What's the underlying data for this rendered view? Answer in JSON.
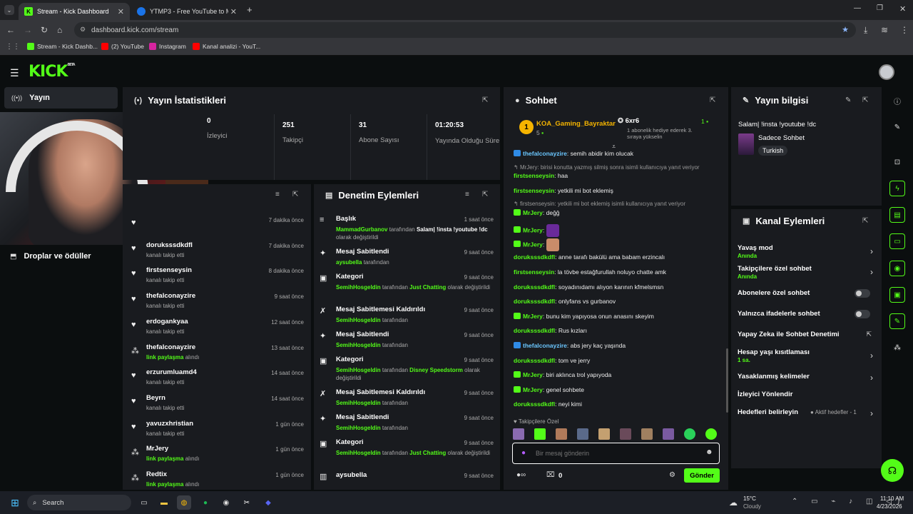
{
  "browser": {
    "tabs": [
      {
        "title": "Stream - Kick Dashboard",
        "active": true
      },
      {
        "title": "YTMP3 - Free YouTube to MP3",
        "active": false
      }
    ],
    "url": "dashboard.kick.com/stream",
    "bookmarks": [
      "Stream - Kick Dashb...",
      "(2) YouTube",
      "Instagram",
      "Kanal analizi - YouT..."
    ]
  },
  "brand": {
    "logo": "KICK",
    "badge": "BETA",
    "accent": "#53fc18"
  },
  "sidebar": {
    "items": [
      {
        "label": "Yayın",
        "icon": "broadcast-icon",
        "active": true
      },
      {
        "label": "Droplar ve ödüller",
        "icon": "drops-icon",
        "active": false
      }
    ]
  },
  "stats": {
    "title": "Yayın İstatistikleri",
    "items": [
      {
        "value": "0",
        "label": "İzleyici"
      },
      {
        "value": "251",
        "label": "Takipçi"
      },
      {
        "value": "31",
        "label": "Abone Sayısı"
      },
      {
        "value": "01:20:53",
        "label": "Yayında Olduğu Süre"
      }
    ]
  },
  "activity": {
    "items": [
      {
        "name": "",
        "sub": "",
        "time": "7 dakika önce",
        "icon": "heart-icon",
        "green": false
      },
      {
        "name": "doruksssdkdfl",
        "sub": "kanalı takip etti",
        "time": "7 dakika önce",
        "icon": "heart-icon",
        "green": false
      },
      {
        "name": "firstsenseysin",
        "sub": "kanalı takip etti",
        "time": "8 dakika önce",
        "icon": "heart-icon",
        "green": false
      },
      {
        "name": "thefalconayzire",
        "sub": "kanalı takip etti",
        "time": "9 saat önce",
        "icon": "heart-icon",
        "green": false
      },
      {
        "name": "erdogankyaa",
        "sub": "kanalı takip etti",
        "time": "12 saat önce",
        "icon": "heart-icon",
        "green": false
      },
      {
        "name": "thefalconayzire",
        "sub": "link paylaşma",
        "sub2": "alındı",
        "time": "13 saat önce",
        "icon": "reward-icon",
        "green": true
      },
      {
        "name": "erzurumluamd4",
        "sub": "kanalı takip etti",
        "time": "14 saat önce",
        "icon": "heart-icon",
        "green": false
      },
      {
        "name": "Beyrn",
        "sub": "kanalı takip etti",
        "time": "14 saat önce",
        "icon": "heart-icon",
        "green": false
      },
      {
        "name": "yavuzxhristian",
        "sub": "kanalı takip etti",
        "time": "1 gün önce",
        "icon": "heart-icon",
        "green": false
      },
      {
        "name": "MrJery",
        "sub": "link paylaşma",
        "sub2": "alındı",
        "time": "1 gün önce",
        "icon": "reward-icon",
        "green": true
      },
      {
        "name": "Redtix",
        "sub": "link paylaşma",
        "sub2": "alındı",
        "time": "1 gün önce",
        "icon": "reward-icon",
        "green": true
      }
    ]
  },
  "moderation": {
    "title": "Denetim Eylemleri",
    "items": [
      {
        "icon": "title-icon",
        "title": "Başlık",
        "time": "1 saat önce",
        "user": "MammadGurbanov",
        "mid": " tarafından ",
        "value": "Salam| !insta !youtube !dc",
        "end": " olarak değiştirildi"
      },
      {
        "icon": "pin-icon",
        "title": "Mesaj Sabitlendi",
        "time": "9 saat önce",
        "user": "aysubella",
        "mid": " tarafından",
        "value": "",
        "end": ""
      },
      {
        "icon": "category-icon",
        "title": "Kategori",
        "time": "9 saat önce",
        "user": "SemihHosgeldin",
        "mid": " tarafından ",
        "value": "Just Chatting",
        "end": " olarak değiştirildi"
      },
      {
        "icon": "unpin-icon",
        "title": "Mesaj Sabitlemesi Kaldırıldı",
        "time": "9 saat önce",
        "user": "SemihHosgeldin",
        "mid": " tarafından",
        "value": "",
        "end": ""
      },
      {
        "icon": "pin-icon",
        "title": "Mesaj Sabitlendi",
        "time": "9 saat önce",
        "user": "SemihHosgeldin",
        "mid": " tarafından",
        "value": "",
        "end": ""
      },
      {
        "icon": "category-icon",
        "title": "Kategori",
        "time": "9 saat önce",
        "user": "SemihHosgeldin",
        "mid": " tarafından ",
        "value": "Disney Speedstorm",
        "end": " olarak değiştirildi"
      },
      {
        "icon": "unpin-icon",
        "title": "Mesaj Sabitlemesi Kaldırıldı",
        "time": "9 saat önce",
        "user": "SemihHosgeldin",
        "mid": " tarafından",
        "value": "",
        "end": ""
      },
      {
        "icon": "pin-icon",
        "title": "Mesaj Sabitlendi",
        "time": "9 saat önce",
        "user": "SemihHosgeldin",
        "mid": " tarafından",
        "value": "",
        "end": ""
      },
      {
        "icon": "category-icon",
        "title": "Kategori",
        "time": "9 saat önce",
        "user": "SemihHosgeldin",
        "mid": " tarafından ",
        "value": "Just Chatting",
        "end": " olarak değiştirildi"
      },
      {
        "icon": "delete-icon",
        "title": "aysubella",
        "time": "9 saat önce",
        "user": "",
        "mid": "",
        "value": "",
        "end": ""
      }
    ]
  },
  "chat": {
    "title": "Sohbet",
    "top_gifter": {
      "rank": "1",
      "name": "KOA_Gaming_Bayraktar",
      "count": "5",
      "badge_count": "1"
    },
    "gift_goal": {
      "label": "6xr6",
      "text": "1 abonelik hediye ederek 3. sıraya yükselin"
    },
    "messages": [
      {
        "type": "msg",
        "user": "thefalconayzire",
        "text": ": semih abidir kim olucak",
        "blue": true
      },
      {
        "type": "sys",
        "text": "MrJery: birisi konutta yazmış silmiş sonra isimli kullanıcıya yanıt veriyor"
      },
      {
        "type": "msg",
        "user": "firstsenseysin",
        "text": ": haa",
        "blue": false
      },
      {
        "type": "msg",
        "user": "firstsenseysin",
        "text": ": yetkili mi bot eklemiş",
        "blue": false
      },
      {
        "type": "sys",
        "text": "firstsenseysin: yetkili mi bot eklemiş isimli kullanıcıya yanıt veriyor"
      },
      {
        "type": "msg",
        "user": "MrJery",
        "text": ": değğ",
        "blue": false
      },
      {
        "type": "msg",
        "user": "MrJery",
        "text": ":",
        "blue": false
      },
      {
        "type": "msg",
        "user": "MrJery",
        "text": ":",
        "blue": false
      },
      {
        "type": "msg",
        "user": "doruksssdkdfl",
        "text": ": anne tarafı bakülü ama babam erzincalı",
        "blue": false
      },
      {
        "type": "msg",
        "user": "firstsenseysin",
        "text": ": la tövbe estağfurullah noluyo chatte amk",
        "blue": false
      },
      {
        "type": "msg",
        "user": "doruksssdkdfl",
        "text": ": soyadınıdamı alıyon karının kfmelsmsn",
        "blue": false
      },
      {
        "type": "msg",
        "user": "doruksssdkdfl",
        "text": ": onlyfans vs gurbanov",
        "blue": false
      },
      {
        "type": "msg",
        "user": "MrJery",
        "text": ": bunu kim yapıyosa onun anasını skeyim",
        "blue": false
      },
      {
        "type": "msg",
        "user": "doruksssdkdfl",
        "text": ": Rus kızları",
        "blue": false
      },
      {
        "type": "msg",
        "user": "thefalconayzire",
        "text": ": abs jery kaç yaşında",
        "blue": true
      },
      {
        "type": "msg",
        "user": "doruksssdkdfl",
        "text": ": tom ve jerry",
        "blue": false
      },
      {
        "type": "msg",
        "user": "MrJery",
        "text": ": biri aklınca trol yapıyoda",
        "blue": false
      },
      {
        "type": "msg",
        "user": "MrJery",
        "text": ": genel sohbete",
        "blue": false
      },
      {
        "type": "msg",
        "user": "doruksssdkdfl",
        "text": ": neyi kimi",
        "blue": false
      }
    ],
    "followers_only": "Takipçilere Özel",
    "input_placeholder": "Bir mesaj gönderin",
    "points": "0",
    "send_label": "Gönder"
  },
  "stream_info": {
    "title": "Yayın bilgisi",
    "stream_title": "Salam| !insta !youtube !dc",
    "category": "Sadece Sohbet",
    "language": "Turkish"
  },
  "channel_actions": {
    "title": "Kanal Eylemleri",
    "items": [
      {
        "label": "Yavaş mod",
        "sub": "Anında",
        "control": "chevron"
      },
      {
        "label": "Takipçilere özel sohbet",
        "sub": "Anında",
        "control": "chevron"
      },
      {
        "label": "Abonelere özel sohbet",
        "sub": "",
        "control": "toggle"
      },
      {
        "label": "Yalnızca ifadelerle sohbet",
        "sub": "",
        "control": "toggle"
      },
      {
        "label": "Yapay Zeka ile Sohbet Denetimi",
        "sub": "",
        "control": "external"
      },
      {
        "label": "Hesap yaşı kısıtlaması",
        "sub": "1 sa.",
        "control": "chevron"
      },
      {
        "label": "Yasaklanmış kelimeler",
        "sub": "",
        "control": "chevron"
      },
      {
        "label": "İzleyici Yönlendir",
        "sub": "",
        "control": "none"
      },
      {
        "label": "Hedefleri belirleyin",
        "sub": "",
        "status": "Aktif hedefler - 1",
        "control": "chevron"
      }
    ]
  },
  "taskbar": {
    "search": "Search",
    "weather_temp": "15°C",
    "weather_desc": "Cloudy",
    "time": "11:10 AM",
    "date": "4/23/2026"
  }
}
